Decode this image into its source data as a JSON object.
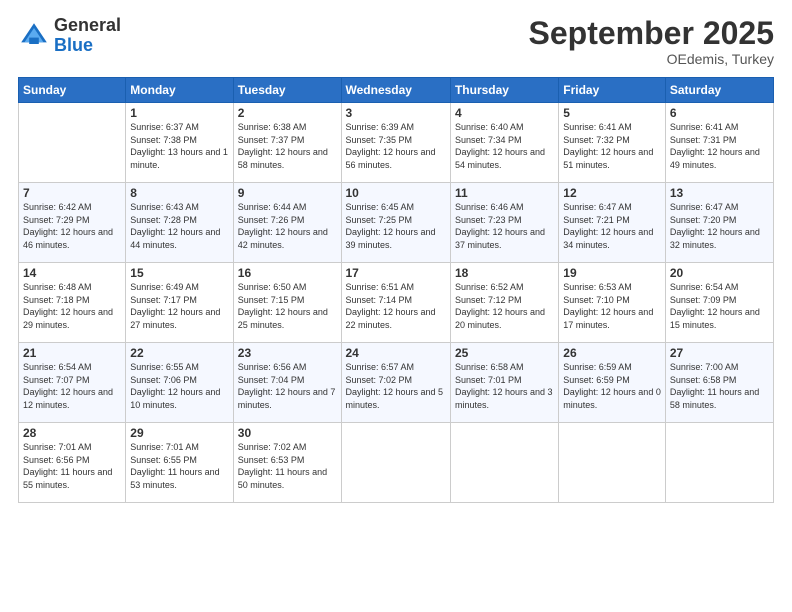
{
  "header": {
    "logo_general": "General",
    "logo_blue": "Blue",
    "month_title": "September 2025",
    "subtitle": "OEdemis, Turkey"
  },
  "weekdays": [
    "Sunday",
    "Monday",
    "Tuesday",
    "Wednesday",
    "Thursday",
    "Friday",
    "Saturday"
  ],
  "weeks": [
    [
      {
        "day": "",
        "sunrise": "",
        "sunset": "",
        "daylight": ""
      },
      {
        "day": "1",
        "sunrise": "Sunrise: 6:37 AM",
        "sunset": "Sunset: 7:38 PM",
        "daylight": "Daylight: 13 hours and 1 minute."
      },
      {
        "day": "2",
        "sunrise": "Sunrise: 6:38 AM",
        "sunset": "Sunset: 7:37 PM",
        "daylight": "Daylight: 12 hours and 58 minutes."
      },
      {
        "day": "3",
        "sunrise": "Sunrise: 6:39 AM",
        "sunset": "Sunset: 7:35 PM",
        "daylight": "Daylight: 12 hours and 56 minutes."
      },
      {
        "day": "4",
        "sunrise": "Sunrise: 6:40 AM",
        "sunset": "Sunset: 7:34 PM",
        "daylight": "Daylight: 12 hours and 54 minutes."
      },
      {
        "day": "5",
        "sunrise": "Sunrise: 6:41 AM",
        "sunset": "Sunset: 7:32 PM",
        "daylight": "Daylight: 12 hours and 51 minutes."
      },
      {
        "day": "6",
        "sunrise": "Sunrise: 6:41 AM",
        "sunset": "Sunset: 7:31 PM",
        "daylight": "Daylight: 12 hours and 49 minutes."
      }
    ],
    [
      {
        "day": "7",
        "sunrise": "Sunrise: 6:42 AM",
        "sunset": "Sunset: 7:29 PM",
        "daylight": "Daylight: 12 hours and 46 minutes."
      },
      {
        "day": "8",
        "sunrise": "Sunrise: 6:43 AM",
        "sunset": "Sunset: 7:28 PM",
        "daylight": "Daylight: 12 hours and 44 minutes."
      },
      {
        "day": "9",
        "sunrise": "Sunrise: 6:44 AM",
        "sunset": "Sunset: 7:26 PM",
        "daylight": "Daylight: 12 hours and 42 minutes."
      },
      {
        "day": "10",
        "sunrise": "Sunrise: 6:45 AM",
        "sunset": "Sunset: 7:25 PM",
        "daylight": "Daylight: 12 hours and 39 minutes."
      },
      {
        "day": "11",
        "sunrise": "Sunrise: 6:46 AM",
        "sunset": "Sunset: 7:23 PM",
        "daylight": "Daylight: 12 hours and 37 minutes."
      },
      {
        "day": "12",
        "sunrise": "Sunrise: 6:47 AM",
        "sunset": "Sunset: 7:21 PM",
        "daylight": "Daylight: 12 hours and 34 minutes."
      },
      {
        "day": "13",
        "sunrise": "Sunrise: 6:47 AM",
        "sunset": "Sunset: 7:20 PM",
        "daylight": "Daylight: 12 hours and 32 minutes."
      }
    ],
    [
      {
        "day": "14",
        "sunrise": "Sunrise: 6:48 AM",
        "sunset": "Sunset: 7:18 PM",
        "daylight": "Daylight: 12 hours and 29 minutes."
      },
      {
        "day": "15",
        "sunrise": "Sunrise: 6:49 AM",
        "sunset": "Sunset: 7:17 PM",
        "daylight": "Daylight: 12 hours and 27 minutes."
      },
      {
        "day": "16",
        "sunrise": "Sunrise: 6:50 AM",
        "sunset": "Sunset: 7:15 PM",
        "daylight": "Daylight: 12 hours and 25 minutes."
      },
      {
        "day": "17",
        "sunrise": "Sunrise: 6:51 AM",
        "sunset": "Sunset: 7:14 PM",
        "daylight": "Daylight: 12 hours and 22 minutes."
      },
      {
        "day": "18",
        "sunrise": "Sunrise: 6:52 AM",
        "sunset": "Sunset: 7:12 PM",
        "daylight": "Daylight: 12 hours and 20 minutes."
      },
      {
        "day": "19",
        "sunrise": "Sunrise: 6:53 AM",
        "sunset": "Sunset: 7:10 PM",
        "daylight": "Daylight: 12 hours and 17 minutes."
      },
      {
        "day": "20",
        "sunrise": "Sunrise: 6:54 AM",
        "sunset": "Sunset: 7:09 PM",
        "daylight": "Daylight: 12 hours and 15 minutes."
      }
    ],
    [
      {
        "day": "21",
        "sunrise": "Sunrise: 6:54 AM",
        "sunset": "Sunset: 7:07 PM",
        "daylight": "Daylight: 12 hours and 12 minutes."
      },
      {
        "day": "22",
        "sunrise": "Sunrise: 6:55 AM",
        "sunset": "Sunset: 7:06 PM",
        "daylight": "Daylight: 12 hours and 10 minutes."
      },
      {
        "day": "23",
        "sunrise": "Sunrise: 6:56 AM",
        "sunset": "Sunset: 7:04 PM",
        "daylight": "Daylight: 12 hours and 7 minutes."
      },
      {
        "day": "24",
        "sunrise": "Sunrise: 6:57 AM",
        "sunset": "Sunset: 7:02 PM",
        "daylight": "Daylight: 12 hours and 5 minutes."
      },
      {
        "day": "25",
        "sunrise": "Sunrise: 6:58 AM",
        "sunset": "Sunset: 7:01 PM",
        "daylight": "Daylight: 12 hours and 3 minutes."
      },
      {
        "day": "26",
        "sunrise": "Sunrise: 6:59 AM",
        "sunset": "Sunset: 6:59 PM",
        "daylight": "Daylight: 12 hours and 0 minutes."
      },
      {
        "day": "27",
        "sunrise": "Sunrise: 7:00 AM",
        "sunset": "Sunset: 6:58 PM",
        "daylight": "Daylight: 11 hours and 58 minutes."
      }
    ],
    [
      {
        "day": "28",
        "sunrise": "Sunrise: 7:01 AM",
        "sunset": "Sunset: 6:56 PM",
        "daylight": "Daylight: 11 hours and 55 minutes."
      },
      {
        "day": "29",
        "sunrise": "Sunrise: 7:01 AM",
        "sunset": "Sunset: 6:55 PM",
        "daylight": "Daylight: 11 hours and 53 minutes."
      },
      {
        "day": "30",
        "sunrise": "Sunrise: 7:02 AM",
        "sunset": "Sunset: 6:53 PM",
        "daylight": "Daylight: 11 hours and 50 minutes."
      },
      {
        "day": "",
        "sunrise": "",
        "sunset": "",
        "daylight": ""
      },
      {
        "day": "",
        "sunrise": "",
        "sunset": "",
        "daylight": ""
      },
      {
        "day": "",
        "sunrise": "",
        "sunset": "",
        "daylight": ""
      },
      {
        "day": "",
        "sunrise": "",
        "sunset": "",
        "daylight": ""
      }
    ]
  ]
}
